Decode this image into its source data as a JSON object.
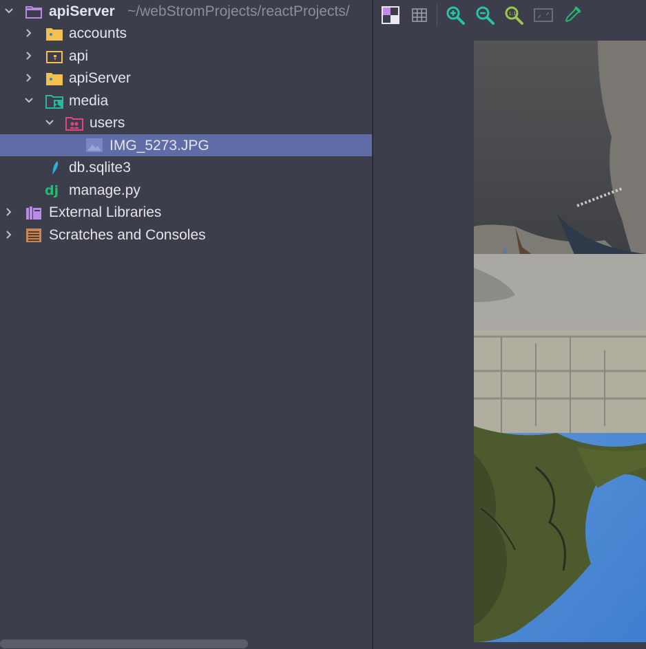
{
  "tree": {
    "root": {
      "name": "apiServer",
      "path": "~/webStromProjects/reactProjects/"
    },
    "items": [
      {
        "label": "accounts"
      },
      {
        "label": "api"
      },
      {
        "label": "apiServer"
      },
      {
        "label": "media"
      },
      {
        "label": "users"
      },
      {
        "label": "IMG_5273.JPG"
      },
      {
        "label": "db.sqlite3"
      },
      {
        "label": "manage.py"
      },
      {
        "label": "External Libraries"
      },
      {
        "label": "Scratches and Consoles"
      }
    ]
  },
  "toolbar": {
    "icons": [
      "chessboard-icon",
      "grid-icon",
      "zoom-in-icon",
      "zoom-out-icon",
      "actual-size-icon",
      "fit-icon",
      "color-picker-icon"
    ]
  },
  "colors": {
    "background": "#3c3f4b",
    "selection": "#5f6ca6",
    "text": "#e3e5ea",
    "folder": "#f2c14e",
    "accent_teal": "#27b99b",
    "accent_purple": "#b98ae6"
  }
}
